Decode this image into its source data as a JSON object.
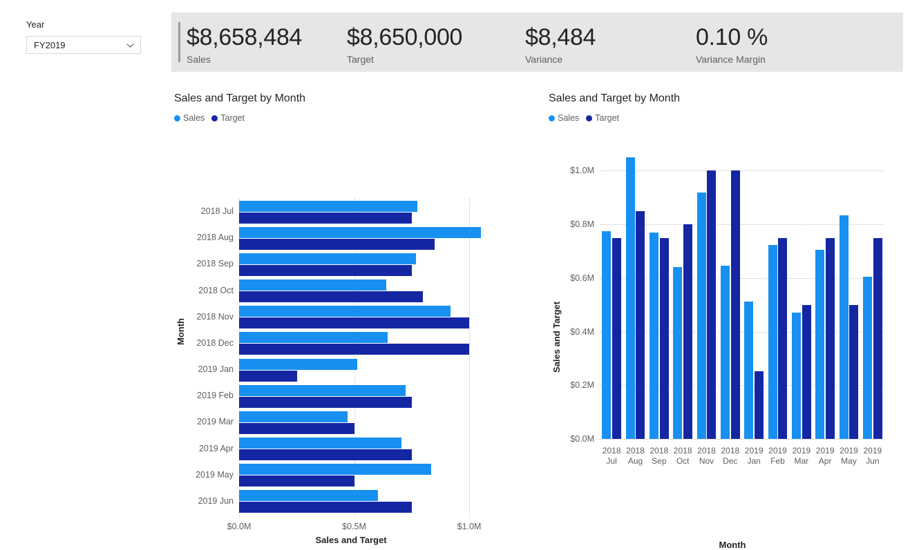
{
  "slicer": {
    "label": "Year",
    "value": "FY2019",
    "icon": "chevron-down-icon"
  },
  "kpis": [
    {
      "value": "$8,658,484",
      "label": "Sales"
    },
    {
      "value": "$8,650,000",
      "label": "Target"
    },
    {
      "value": "$8,484",
      "label": "Variance"
    },
    {
      "value": "0.10 %",
      "label": "Variance Margin"
    }
  ],
  "colors": {
    "sales": "#1890f1",
    "target": "#1526a3",
    "kpi_band": "#e6e6e6",
    "axis_text": "#605e5c",
    "title_text": "#252423",
    "gridline": "#c8c6c4"
  },
  "visuals": {
    "left": {
      "title": "Sales and Target by Month",
      "legend": [
        {
          "name": "Sales",
          "color": "#1890f1"
        },
        {
          "name": "Target",
          "color": "#1526a3"
        }
      ],
      "axis_title_value": "Sales and Target",
      "axis_title_category": "Month"
    },
    "right": {
      "title": "Sales and Target by Month",
      "legend": [
        {
          "name": "Sales",
          "color": "#1890f1"
        },
        {
          "name": "Target",
          "color": "#1526a3"
        }
      ],
      "axis_title_value": "Sales and Target",
      "axis_title_category": "Month"
    }
  },
  "chart_data": [
    {
      "type": "bar",
      "orientation": "horizontal",
      "title": "Sales and Target by Month",
      "xlabel": "Sales and Target",
      "ylabel": "Month",
      "xlim": [
        0,
        1.0
      ],
      "xticks": [
        0,
        0.5,
        1.0
      ],
      "xticklabels": [
        "$0.0M",
        "$0.5M",
        "$1.0M"
      ],
      "unit": "millions USD",
      "grid": true,
      "legend_position": "top-left",
      "categories": [
        "2018 Jul",
        "2018 Aug",
        "2018 Sep",
        "2018 Oct",
        "2018 Nov",
        "2018 Dec",
        "2019 Jan",
        "2019 Feb",
        "2019 Mar",
        "2019 Apr",
        "2019 May",
        "2019 Jun"
      ],
      "series": [
        {
          "name": "Sales",
          "color": "#1890f1",
          "values": [
            0.775,
            1.05,
            0.77,
            0.64,
            0.92,
            0.645,
            0.513,
            0.723,
            0.471,
            0.705,
            0.835,
            0.605
          ]
        },
        {
          "name": "Target",
          "color": "#1526a3",
          "values": [
            0.75,
            0.85,
            0.75,
            0.8,
            1.0,
            1.0,
            0.252,
            0.75,
            0.5,
            0.75,
            0.5,
            0.75
          ]
        }
      ]
    },
    {
      "type": "bar",
      "orientation": "vertical",
      "title": "Sales and Target by Month",
      "xlabel": "Month",
      "ylabel": "Sales and Target",
      "ylim": [
        0,
        1.05
      ],
      "yticks": [
        0.0,
        0.2,
        0.4,
        0.6,
        0.8,
        1.0
      ],
      "yticklabels": [
        "$0.0M",
        "$0.2M",
        "$0.4M",
        "$0.6M",
        "$0.8M",
        "$1.0M"
      ],
      "unit": "millions USD",
      "grid": true,
      "legend_position": "top-left",
      "categories": [
        "2018 Jul",
        "2018 Aug",
        "2018 Sep",
        "2018 Oct",
        "2018 Nov",
        "2018 Dec",
        "2019 Jan",
        "2019 Feb",
        "2019 Mar",
        "2019 Apr",
        "2019 May",
        "2019 Jun"
      ],
      "categories_line1": [
        "2018",
        "2018",
        "2018",
        "2018",
        "2018",
        "2018",
        "2019",
        "2019",
        "2019",
        "2019",
        "2019",
        "2019"
      ],
      "categories_line2": [
        "Jul",
        "Aug",
        "Sep",
        "Oct",
        "Nov",
        "Dec",
        "Jan",
        "Feb",
        "Mar",
        "Apr",
        "May",
        "Jun"
      ],
      "series": [
        {
          "name": "Sales",
          "color": "#1890f1",
          "values": [
            0.775,
            1.05,
            0.77,
            0.64,
            0.92,
            0.645,
            0.513,
            0.723,
            0.471,
            0.705,
            0.835,
            0.605
          ]
        },
        {
          "name": "Target",
          "color": "#1526a3",
          "values": [
            0.75,
            0.85,
            0.75,
            0.8,
            1.0,
            1.0,
            0.252,
            0.75,
            0.5,
            0.75,
            0.5,
            0.75
          ]
        }
      ]
    }
  ]
}
